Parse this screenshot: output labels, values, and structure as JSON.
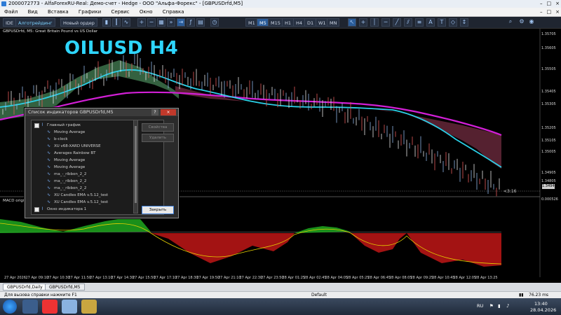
{
  "titlebar": {
    "title": "2000072773 - AlfaForexRU-Real: Демо-счет - Hedge - ООО \"Альфа-Форекс\" - [GBPUSDrfd,M5]",
    "minimize": "–",
    "maximize": "□",
    "close": "×"
  },
  "menu": {
    "items": [
      "Файл",
      "Вид",
      "Вставка",
      "Графики",
      "Сервис",
      "Окно",
      "Справка"
    ],
    "minimize": "–",
    "restore": "□",
    "close": "×"
  },
  "toolbar": {
    "ide": "IDE",
    "algo": "Алготрейдинг",
    "new_order": "Новый ордер",
    "timeframes": [
      "M1",
      "M5",
      "M15",
      "H1",
      "H4",
      "D1",
      "W1",
      "MN"
    ],
    "active_timeframe": "M5"
  },
  "chart": {
    "header": "GBPUSDrfd, M5:  Great Britain Pound vs US Dollar",
    "overlay_label": "OILUSD H4",
    "macd_label": "MACD original",
    "price_box": "1.34940",
    "countdown": "<3:16",
    "y_ticks": [
      "1.35705",
      "1.35605",
      "1.35505",
      "1.35405",
      "1.35305",
      "1.35205",
      "1.35105",
      "1.35005",
      "1.34905",
      "1.34805",
      "0.000526"
    ],
    "x_ticks": [
      "27 Apr 2026",
      "27 Apr 09:10",
      "27 Apr 10:30",
      "27 Apr 11:50",
      "27 Apr 13:10",
      "27 Apr 14:30",
      "27 Apr 15:50",
      "27 Apr 17:10",
      "27 Apr 18:30",
      "27 Apr 19:50",
      "27 Apr 21:10",
      "27 Apr 22:30",
      "27 Apr 23:50",
      "28 Apr 01:25",
      "28 Apr 02:45",
      "28 Apr 04:05",
      "28 Apr 05:25",
      "28 Apr 06:45",
      "28 Apr 08:05",
      "28 Apr 09:25",
      "28 Apr 10:45",
      "28 Apr 12:05",
      "28 Apr 13:25"
    ],
    "colors": {
      "fast_ma": "#2bd0e8",
      "slow_ma": "#d21fd6",
      "bull_fill": "#3a6b47",
      "bear_fill": "#6a2b3a",
      "macd_pos": "#1fa81f",
      "macd_neg": "#b51515",
      "signal": "#e6d000"
    }
  },
  "dialog": {
    "title": "Список индикаторов GBPUSDrfd,M5",
    "help": "?",
    "close": "×",
    "tree": [
      {
        "label": "Главный график",
        "level": 0
      },
      {
        "label": "Moving Average",
        "level": 1
      },
      {
        "label": "b-clock",
        "level": 1
      },
      {
        "label": "XU v68-XARD UNIVERSE",
        "level": 1
      },
      {
        "label": "Averages Rainbow BT",
        "level": 1
      },
      {
        "label": "Moving Average",
        "level": 1
      },
      {
        "label": "Moving Average",
        "level": 1
      },
      {
        "label": "ma_-_ribbon_2_2",
        "level": 1
      },
      {
        "label": "ma_-_ribbon_2_2",
        "level": 1
      },
      {
        "label": "ma_-_ribbon_2_2",
        "level": 1
      },
      {
        "label": "XU Candles EMA v.5.12_test",
        "level": 1
      },
      {
        "label": "XU Candles EMA v.5.12_test",
        "level": 1
      },
      {
        "label": "Окно индикатора 1",
        "level": 0
      }
    ],
    "properties": "Свойства",
    "delete": "Удалить",
    "close_button": "Закрыть"
  },
  "tabs": [
    "GBPUSDrfd,Daily",
    "GBPUSDrfd,M5"
  ],
  "status": {
    "help": "Для вызова справки нажмите F1",
    "profile": "Default",
    "ping": "76.23 ms"
  },
  "taskbar": {
    "lang": "RU",
    "time": "13:40",
    "date": "28.04.2026"
  }
}
